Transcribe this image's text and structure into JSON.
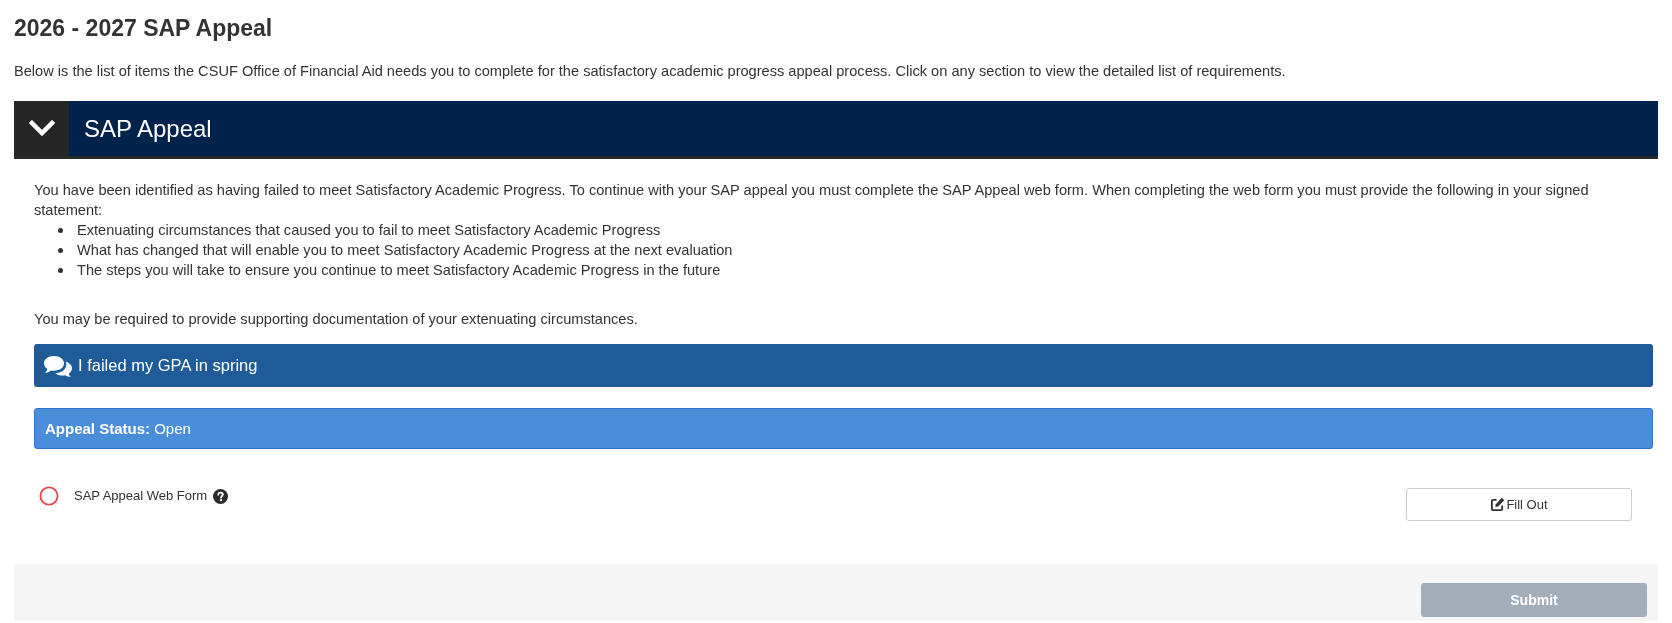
{
  "page": {
    "title": "2026 - 2027 SAP Appeal",
    "intro": "Below is the list of items the CSUF Office of Financial Aid needs you to complete for the satisfactory academic progress appeal process. Click on any section to view the detailed list of requirements."
  },
  "section": {
    "title": "SAP Appeal",
    "expanded": true,
    "description": "You have been identified as having failed to meet Satisfactory Academic Progress. To continue with your SAP appeal you must complete the SAP Appeal web form. When completing the web form you must provide the following in your signed statement:",
    "bullets": [
      "Extenuating circumstances that caused you to fail to meet Satisfactory Academic Progress",
      "What has changed that will enable you to meet Satisfactory Academic Progress at the next evaluation",
      "The steps you will take to ensure you continue to meet Satisfactory Academic Progress in the future"
    ],
    "note": "You may be required to provide supporting documentation of your extenuating circumstances.",
    "appeal": {
      "reason": "I failed my GPA in spring",
      "status": "**Appeal Status:** Open"
    },
    "requirements": [
      {
        "label": "SAP Appeal Web Form",
        "completed": false,
        "action": "Fill Out"
      }
    ]
  },
  "footer": {
    "submit": {
      "label": "Submit",
      "disabled": true
    }
  }
}
